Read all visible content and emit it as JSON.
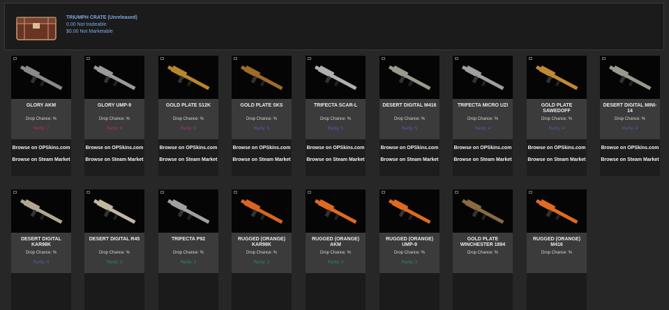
{
  "crate": {
    "title": "TRIUMPH CRATE (Unreleased)",
    "line1": "0.00 Not tradeable",
    "line2": "$0.00 Not Marketable"
  },
  "links": {
    "opskins": "Browse on OPSkins.com",
    "steam": "Browse on Steam Market"
  },
  "items": [
    {
      "name": "GLORY AKM",
      "chance": "Drop Chance: %",
      "rarity": "Rarity: 7",
      "rarity_color": "#b5344e",
      "gun_color": "#8a8a8a"
    },
    {
      "name": "GLORY UMP-9",
      "chance": "Drop Chance: %",
      "rarity": "Rarity: 6",
      "rarity_color": "#a8327d",
      "gun_color": "#9a9a9a"
    },
    {
      "name": "GOLD PLATE S12K",
      "chance": "Drop Chance: %",
      "rarity": "Rarity: 6",
      "rarity_color": "#a8327d",
      "gun_color": "#b8862b"
    },
    {
      "name": "GOLD PLATE SKS",
      "chance": "Drop Chance: %",
      "rarity": "Rarity: 5",
      "rarity_color": "#6a51b8",
      "gun_color": "#a06a2a"
    },
    {
      "name": "TRIFECTA SCAR-L",
      "chance": "Drop Chance: %",
      "rarity": "Rarity: 5",
      "rarity_color": "#6a51b8",
      "gun_color": "#b0b0b0"
    },
    {
      "name": "DESERT DIGITAL M416",
      "chance": "Drop Chance: %",
      "rarity": "Rarity: 5",
      "rarity_color": "#6a51b8",
      "gun_color": "#9a9a8a"
    },
    {
      "name": "TRIFECTA MICRO UZI",
      "chance": "Drop Chance: %",
      "rarity": "Rarity: 4",
      "rarity_color": "#4f5fb0",
      "gun_color": "#a0a0a0"
    },
    {
      "name": "GOLD PLATE SAWEDOFF",
      "chance": "Drop Chance: %",
      "rarity": "Rarity: 4",
      "rarity_color": "#4f5fb0",
      "gun_color": "#c08a30"
    },
    {
      "name": "DESERT DIGITAL MINI-14",
      "chance": "Drop Chance: %",
      "rarity": "Rarity: 4",
      "rarity_color": "#4f5fb0",
      "gun_color": "#9a9a8a"
    },
    {
      "name": "DESERT DIGITAL KAR98K",
      "chance": "Drop Chance: %",
      "rarity": "Rarity: 4",
      "rarity_color": "#4f5fb0",
      "gun_color": "#b0a890"
    },
    {
      "name": "DESERT DIGITAL R45",
      "chance": "Drop Chance: %",
      "rarity": "Rarity: 3",
      "rarity_color": "#2f8a6e",
      "gun_color": "#c0b8a0"
    },
    {
      "name": "TRIFECTA P92",
      "chance": "Drop Chance: %",
      "rarity": "Rarity: 3",
      "rarity_color": "#2f8a6e",
      "gun_color": "#a0a0a0"
    },
    {
      "name": "RUGGED (ORANGE) KAR98K",
      "chance": "Drop Chance: %",
      "rarity": "Rarity: 3",
      "rarity_color": "#2f8a6e",
      "gun_color": "#d8651f"
    },
    {
      "name": "RUGGED (ORANGE) AKM",
      "chance": "Drop Chance: %",
      "rarity": "Rarity: 3",
      "rarity_color": "#2f8a6e",
      "gun_color": "#e06a20"
    },
    {
      "name": "RUGGED (ORANGE) UMP-9",
      "chance": "Drop Chance: %",
      "rarity": "Rarity: 3",
      "rarity_color": "#2f8a6e",
      "gun_color": "#e06a20"
    },
    {
      "name": "GOLD PLATE WINCHESTER 1894",
      "chance": "Drop Chance: %",
      "rarity": "",
      "rarity_color": "#2f8a6e",
      "gun_color": "#8a6a40"
    },
    {
      "name": "RUGGED (ORANGE) M416",
      "chance": "Drop Chance: %",
      "rarity": "",
      "rarity_color": "#2f8a6e",
      "gun_color": "#e06a20"
    }
  ]
}
